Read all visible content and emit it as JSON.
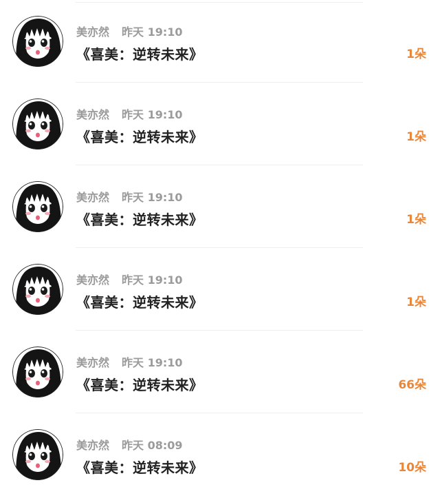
{
  "gifts": [
    {
      "user": "美亦然",
      "time": "昨天 19:10",
      "book": "《喜美：逆转未来》",
      "amount": "1朵"
    },
    {
      "user": "美亦然",
      "time": "昨天 19:10",
      "book": "《喜美：逆转未来》",
      "amount": "1朵"
    },
    {
      "user": "美亦然",
      "time": "昨天 19:10",
      "book": "《喜美：逆转未来》",
      "amount": "1朵"
    },
    {
      "user": "美亦然",
      "time": "昨天 19:10",
      "book": "《喜美：逆转未来》",
      "amount": "1朵"
    },
    {
      "user": "美亦然",
      "time": "昨天 19:10",
      "book": "《喜美：逆转未来》",
      "amount": "66朵"
    },
    {
      "user": "美亦然",
      "time": "昨天 08:09",
      "book": "《喜美：逆转未来》",
      "amount": "10朵"
    }
  ],
  "colors": {
    "amount": "#e8863a",
    "meta": "#9b9b9b",
    "title": "#222222"
  },
  "icons": {
    "avatar": "anime-girl-avatar-icon"
  }
}
